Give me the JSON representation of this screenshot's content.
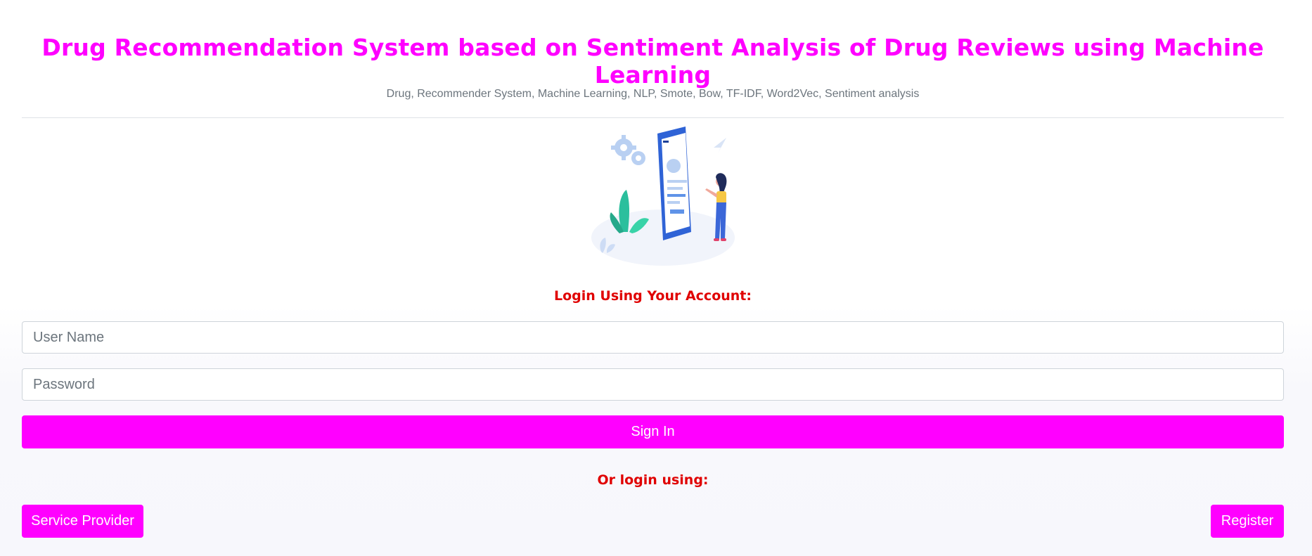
{
  "header": {
    "title": "Drug Recommendation System based on Sentiment Analysis of Drug Reviews using Machine Learning",
    "keywords": "Drug, Recommender System, Machine Learning, NLP, Smote, Bow, TF-IDF, Word2Vec, Sentiment analysis"
  },
  "illustration": {
    "icon": "person-with-phone-illustration"
  },
  "login": {
    "heading": "Login Using Your Account:",
    "username_placeholder": "User Name",
    "password_placeholder": "Password",
    "signin_label": "Sign In",
    "alt_heading": "Or login using:",
    "provider_label": "Service Provider",
    "register_label": "Register"
  },
  "colors": {
    "accent": "#ff00ff",
    "heading_red": "#e00000",
    "muted_text": "#6c757d"
  }
}
